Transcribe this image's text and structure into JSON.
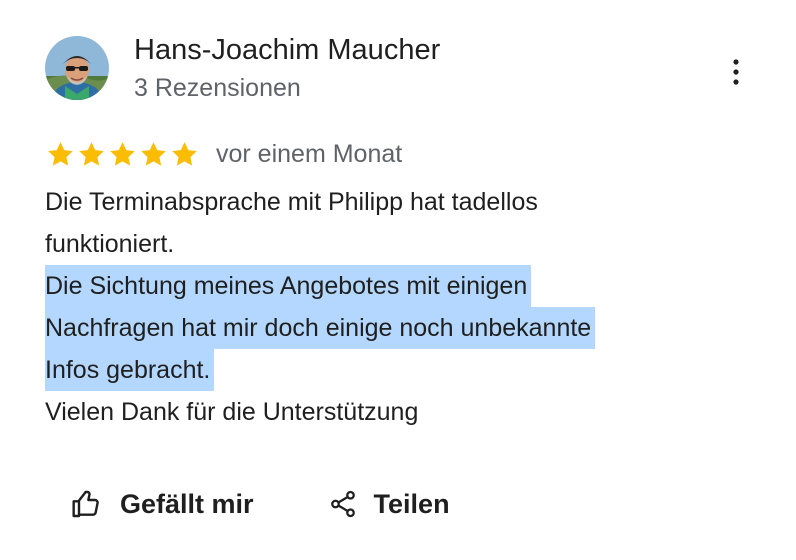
{
  "author": {
    "name": "Hans-Joachim Maucher",
    "reviews_count": "3 Rezensionen",
    "avatar_icon": "user-avatar-photo"
  },
  "menu": {
    "icon": "more-vertical-icon"
  },
  "rating": {
    "stars": 5,
    "max_stars": 5,
    "star_color": "#fbbc04",
    "date": "vor einem Monat"
  },
  "review": {
    "lines": [
      "Die Terminabsprache mit Philipp hat tadellos",
      "funktioniert.",
      "Die Sichtung meines Angebotes mit einigen",
      "Nachfragen hat mir doch einige noch unbekannte",
      "Infos gebracht.",
      "Vielen Dank für die Unterstützung"
    ],
    "highlight_color": "#b3d7ff"
  },
  "actions": {
    "like_label": "Gefällt mir",
    "like_icon": "thumbs-up-icon",
    "share_label": "Teilen",
    "share_icon": "share-icon"
  }
}
